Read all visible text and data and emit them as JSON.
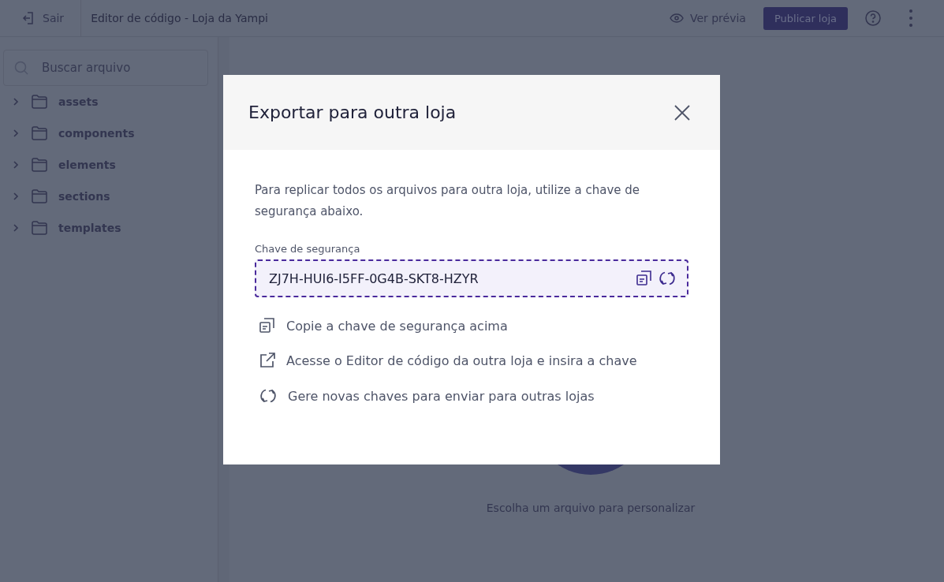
{
  "topbar": {
    "exit_label": "Sair",
    "title": "Editor de código - Loja da Yampi",
    "preview_label": "Ver prévia",
    "publish_label": "Publicar loja"
  },
  "sidebar": {
    "search": {
      "placeholder": "Buscar arquivo"
    },
    "folders": [
      {
        "name": "assets",
        "expanded": false
      },
      {
        "name": "components",
        "expanded": false
      },
      {
        "name": "elements",
        "expanded": false
      },
      {
        "name": "sections",
        "expanded": false
      },
      {
        "name": "templates",
        "expanded": false
      }
    ]
  },
  "empty_state": {
    "message": "Escolha um arquivo para personalizar"
  },
  "modal": {
    "title": "Exportar para outra loja",
    "description": "Para replicar todos os arquivos para outra loja, utilize a chave de segurança abaixo.",
    "key_label": "Chave de segurança",
    "key_value": "ZJ7H-HUI6-I5FF-0G4B-SKT8-HZYR",
    "steps": [
      {
        "kind": "copy",
        "text": "Copie a chave de segurança acima"
      },
      {
        "kind": "external",
        "text": "Acesse o Editor de código da outra loja e insira a chave"
      },
      {
        "kind": "refresh",
        "text": "Gere novas chaves para enviar para outras lojas"
      }
    ]
  }
}
